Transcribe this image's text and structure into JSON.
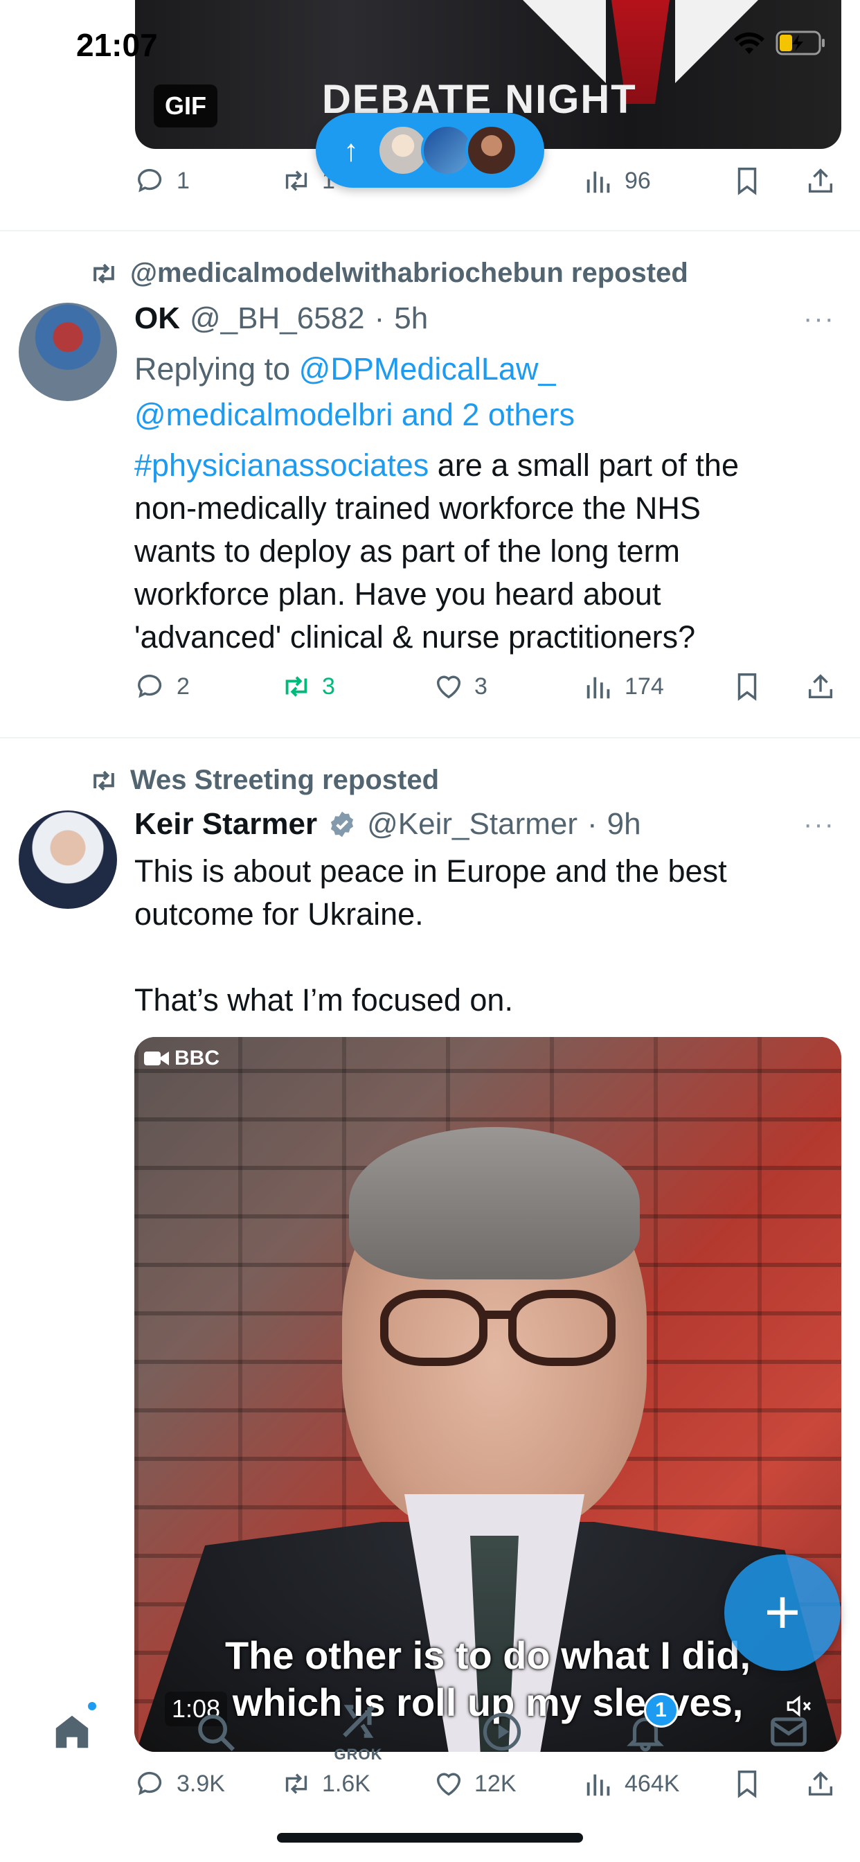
{
  "status_bar": {
    "time": "21:07"
  },
  "tweet1": {
    "media_text": "DEBATE NIGHT",
    "gif_label": "GIF",
    "counts": {
      "replies": "1",
      "reposts": "1",
      "views": "96"
    }
  },
  "new_posts_pill": {
    "arrow": "↑"
  },
  "tweet2": {
    "repost_by": "@medicalmodelwithabriochebun reposted",
    "name": "OK",
    "handle": "@_BH_6582",
    "dot": "·",
    "time": "5h",
    "more": "···",
    "replying_prefix": "Replying to ",
    "replying_to_1": "@DPMedicalLaw_",
    "replying_to_2": "@medicalmodelbri and 2 others",
    "hashtag": "#physicianassociates",
    "text_line1_rest": " are a small part of the",
    "text_line2": "non-medically trained workforce the NHS",
    "text_line3": "wants to deploy as part of the long term",
    "text_line4": "workforce plan. Have you heard about",
    "text_line5": "'advanced' clinical & nurse practitioners?",
    "counts": {
      "replies": "2",
      "reposts": "3",
      "likes": "3",
      "views": "174"
    }
  },
  "tweet3": {
    "repost_by": "Wes Streeting reposted",
    "name": "Keir Starmer",
    "handle": "@Keir_Starmer",
    "dot": "·",
    "time": "9h",
    "more": "···",
    "text_line1": "This is about peace in Europe and the best",
    "text_line2": "outcome for Ukraine.",
    "text_line3": "That’s what I’m focused on.",
    "video": {
      "source_label": "BBC",
      "caption_line1": "The other is to do what I did,",
      "caption_line2": "which is roll up my sleeves,",
      "timer": "1:08"
    },
    "counts": {
      "replies": "3.9K",
      "reposts": "1.6K",
      "likes": "12K",
      "views": "464K"
    }
  },
  "fab": {
    "label": "+"
  },
  "nav": {
    "grok_label": "GROK",
    "notifications_badge": "1"
  },
  "colors": {
    "accent": "#1d9bf0",
    "repost_active": "#00ba7c",
    "muted": "#536471"
  }
}
